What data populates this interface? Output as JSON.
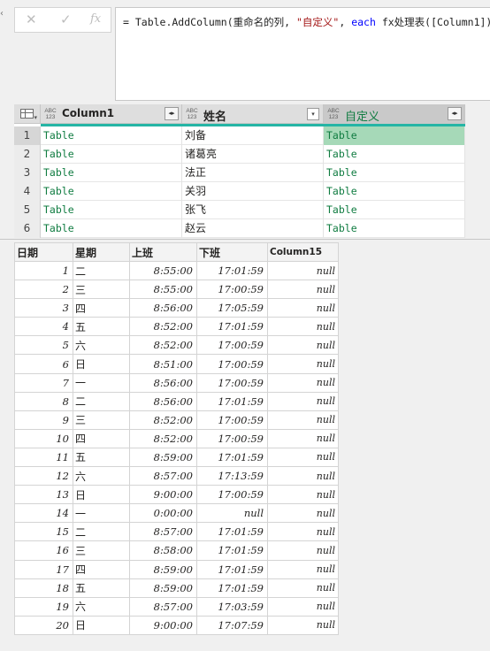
{
  "formula_bar": {
    "cancel_icon": "✕",
    "confirm_icon": "✓",
    "fx_icon": "fx",
    "formula": {
      "prefix": "= Table.AddColumn(重命名的列, ",
      "string": "\"自定义\"",
      "sep": ", ",
      "keyword": "each",
      "suffix": " fx处理表([Column1]))"
    }
  },
  "query_preview": {
    "columns": [
      {
        "type_icon": "ABC 123",
        "label": "Column1",
        "action": "expand"
      },
      {
        "type_icon": "ABC 123",
        "label": "姓名",
        "action": "filter"
      },
      {
        "type_icon": "ABC 123",
        "label": "自定义",
        "action": "expand"
      }
    ],
    "rows": [
      {
        "num": "1",
        "col1": "Table",
        "name": "刘备",
        "custom": "Table"
      },
      {
        "num": "2",
        "col1": "Table",
        "name": "诸葛亮",
        "custom": "Table"
      },
      {
        "num": "3",
        "col1": "Table",
        "name": "法正",
        "custom": "Table"
      },
      {
        "num": "4",
        "col1": "Table",
        "name": "关羽",
        "custom": "Table"
      },
      {
        "num": "5",
        "col1": "Table",
        "name": "张飞",
        "custom": "Table"
      },
      {
        "num": "6",
        "col1": "Table",
        "name": "赵云",
        "custom": "Table"
      }
    ],
    "selected_row": 1,
    "colors": {
      "accent_bar": "#25b5a5",
      "table_link": "#107c41",
      "selected_cell": "#a6d9b8"
    }
  },
  "sheet": {
    "headers": [
      "日期",
      "星期",
      "上班",
      "下班",
      "Column15"
    ],
    "rows": [
      [
        "1",
        "二",
        "8:55:00",
        "17:01:59",
        "null"
      ],
      [
        "2",
        "三",
        "8:55:00",
        "17:00:59",
        "null"
      ],
      [
        "3",
        "四",
        "8:56:00",
        "17:05:59",
        "null"
      ],
      [
        "4",
        "五",
        "8:52:00",
        "17:01:59",
        "null"
      ],
      [
        "5",
        "六",
        "8:52:00",
        "17:00:59",
        "null"
      ],
      [
        "6",
        "日",
        "8:51:00",
        "17:00:59",
        "null"
      ],
      [
        "7",
        "一",
        "8:56:00",
        "17:00:59",
        "null"
      ],
      [
        "8",
        "二",
        "8:56:00",
        "17:01:59",
        "null"
      ],
      [
        "9",
        "三",
        "8:52:00",
        "17:00:59",
        "null"
      ],
      [
        "10",
        "四",
        "8:52:00",
        "17:00:59",
        "null"
      ],
      [
        "11",
        "五",
        "8:59:00",
        "17:01:59",
        "null"
      ],
      [
        "12",
        "六",
        "8:57:00",
        "17:13:59",
        "null"
      ],
      [
        "13",
        "日",
        "9:00:00",
        "17:00:59",
        "null"
      ],
      [
        "14",
        "一",
        "0:00:00",
        "null",
        "null"
      ],
      [
        "15",
        "二",
        "8:57:00",
        "17:01:59",
        "null"
      ],
      [
        "16",
        "三",
        "8:58:00",
        "17:01:59",
        "null"
      ],
      [
        "17",
        "四",
        "8:59:00",
        "17:01:59",
        "null"
      ],
      [
        "18",
        "五",
        "8:59:00",
        "17:01:59",
        "null"
      ],
      [
        "19",
        "六",
        "8:57:00",
        "17:03:59",
        "null"
      ],
      [
        "20",
        "日",
        "9:00:00",
        "17:07:59",
        "null"
      ]
    ]
  }
}
